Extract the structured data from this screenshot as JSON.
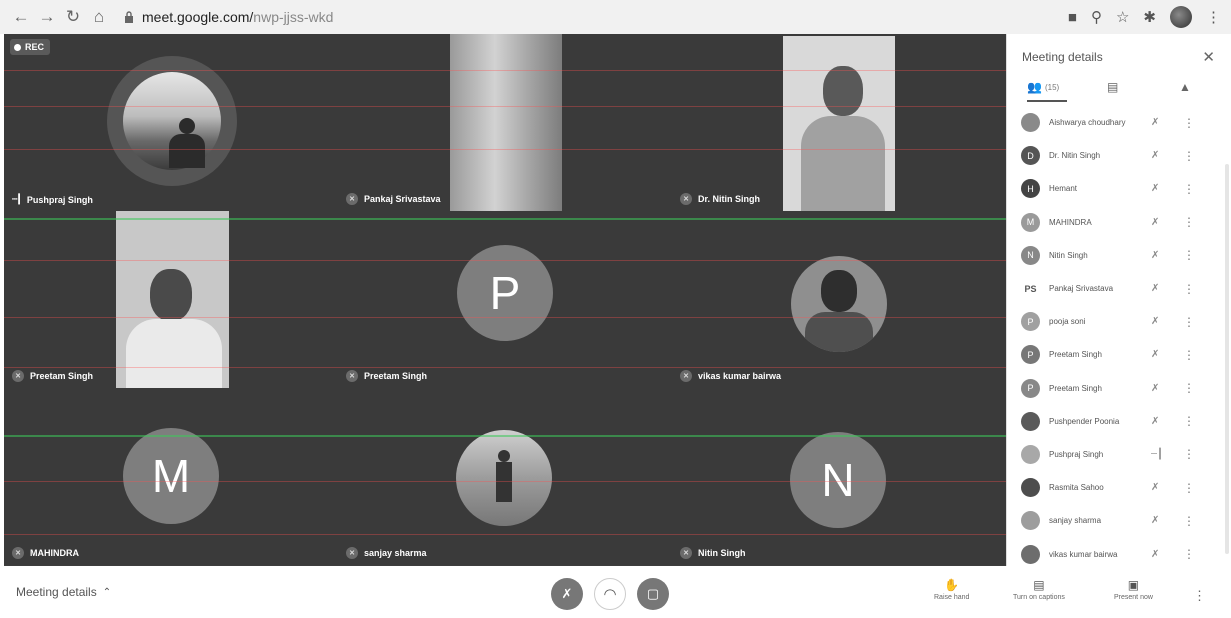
{
  "browser": {
    "url_host": "meet.google.com/",
    "url_path": "nwp-jjss-wkd",
    "icons": [
      "back-icon",
      "forward-icon",
      "reload-icon",
      "home-icon",
      "lock-icon",
      "camera-icon",
      "zoom-icon",
      "star-icon",
      "extensions-icon",
      "profile-avatar",
      "menu-icon"
    ]
  },
  "rec_label": "REC",
  "tiles": [
    {
      "name": "Pushpraj Singh",
      "status": "speaking"
    },
    {
      "name": "Pankaj Srivastava",
      "status": "muted"
    },
    {
      "name": "Dr. Nitin Singh",
      "status": "muted"
    },
    {
      "name": "Preetam Singh",
      "status": "muted"
    },
    {
      "name": "Preetam Singh",
      "status": "muted",
      "initial": "P"
    },
    {
      "name": "vikas kumar bairwa",
      "status": "muted"
    },
    {
      "name": "MAHINDRA",
      "status": "muted",
      "initial": "M"
    },
    {
      "name": "sanjay sharma",
      "status": "muted"
    },
    {
      "name": "Nitin Singh",
      "status": "muted",
      "initial": "N"
    }
  ],
  "panel": {
    "title": "Meeting details",
    "people_count": "(15)",
    "participants": [
      {
        "name": "Aishwarya choudhary",
        "avatar": "photo",
        "mic": "muted"
      },
      {
        "name": "Dr. Nitin Singh",
        "avatar": "D",
        "mic": "muted"
      },
      {
        "name": "Hemant",
        "avatar": "H",
        "mic": "muted"
      },
      {
        "name": "MAHINDRA",
        "avatar": "M",
        "mic": "muted"
      },
      {
        "name": "Nitin Singh",
        "avatar": "N",
        "mic": "muted"
      },
      {
        "name": "Pankaj Srivastava",
        "avatar": "PS",
        "mic": "muted"
      },
      {
        "name": "pooja soni",
        "avatar": "P",
        "mic": "muted"
      },
      {
        "name": "Preetam Singh",
        "avatar": "P",
        "mic": "muted"
      },
      {
        "name": "Preetam Singh",
        "avatar": "P",
        "mic": "muted"
      },
      {
        "name": "Pushpender Poonia",
        "avatar": "photo",
        "mic": "muted"
      },
      {
        "name": "Pushpraj Singh",
        "avatar": "photo",
        "mic": "speaking"
      },
      {
        "name": "Rasmita Sahoo",
        "avatar": "photo",
        "mic": "muted"
      },
      {
        "name": "sanjay sharma",
        "avatar": "photo",
        "mic": "muted"
      },
      {
        "name": "vikas kumar bairwa",
        "avatar": "photo",
        "mic": "muted"
      }
    ]
  },
  "bottom": {
    "meeting_details": "Meeting details",
    "raise_hand": "Raise hand",
    "captions": "Turn on captions",
    "present": "Present now"
  },
  "colors": {
    "tile_bg": "#3a3a3a",
    "avatar_grey": "#7e7e7e",
    "panel_bg": "#ffffff"
  }
}
